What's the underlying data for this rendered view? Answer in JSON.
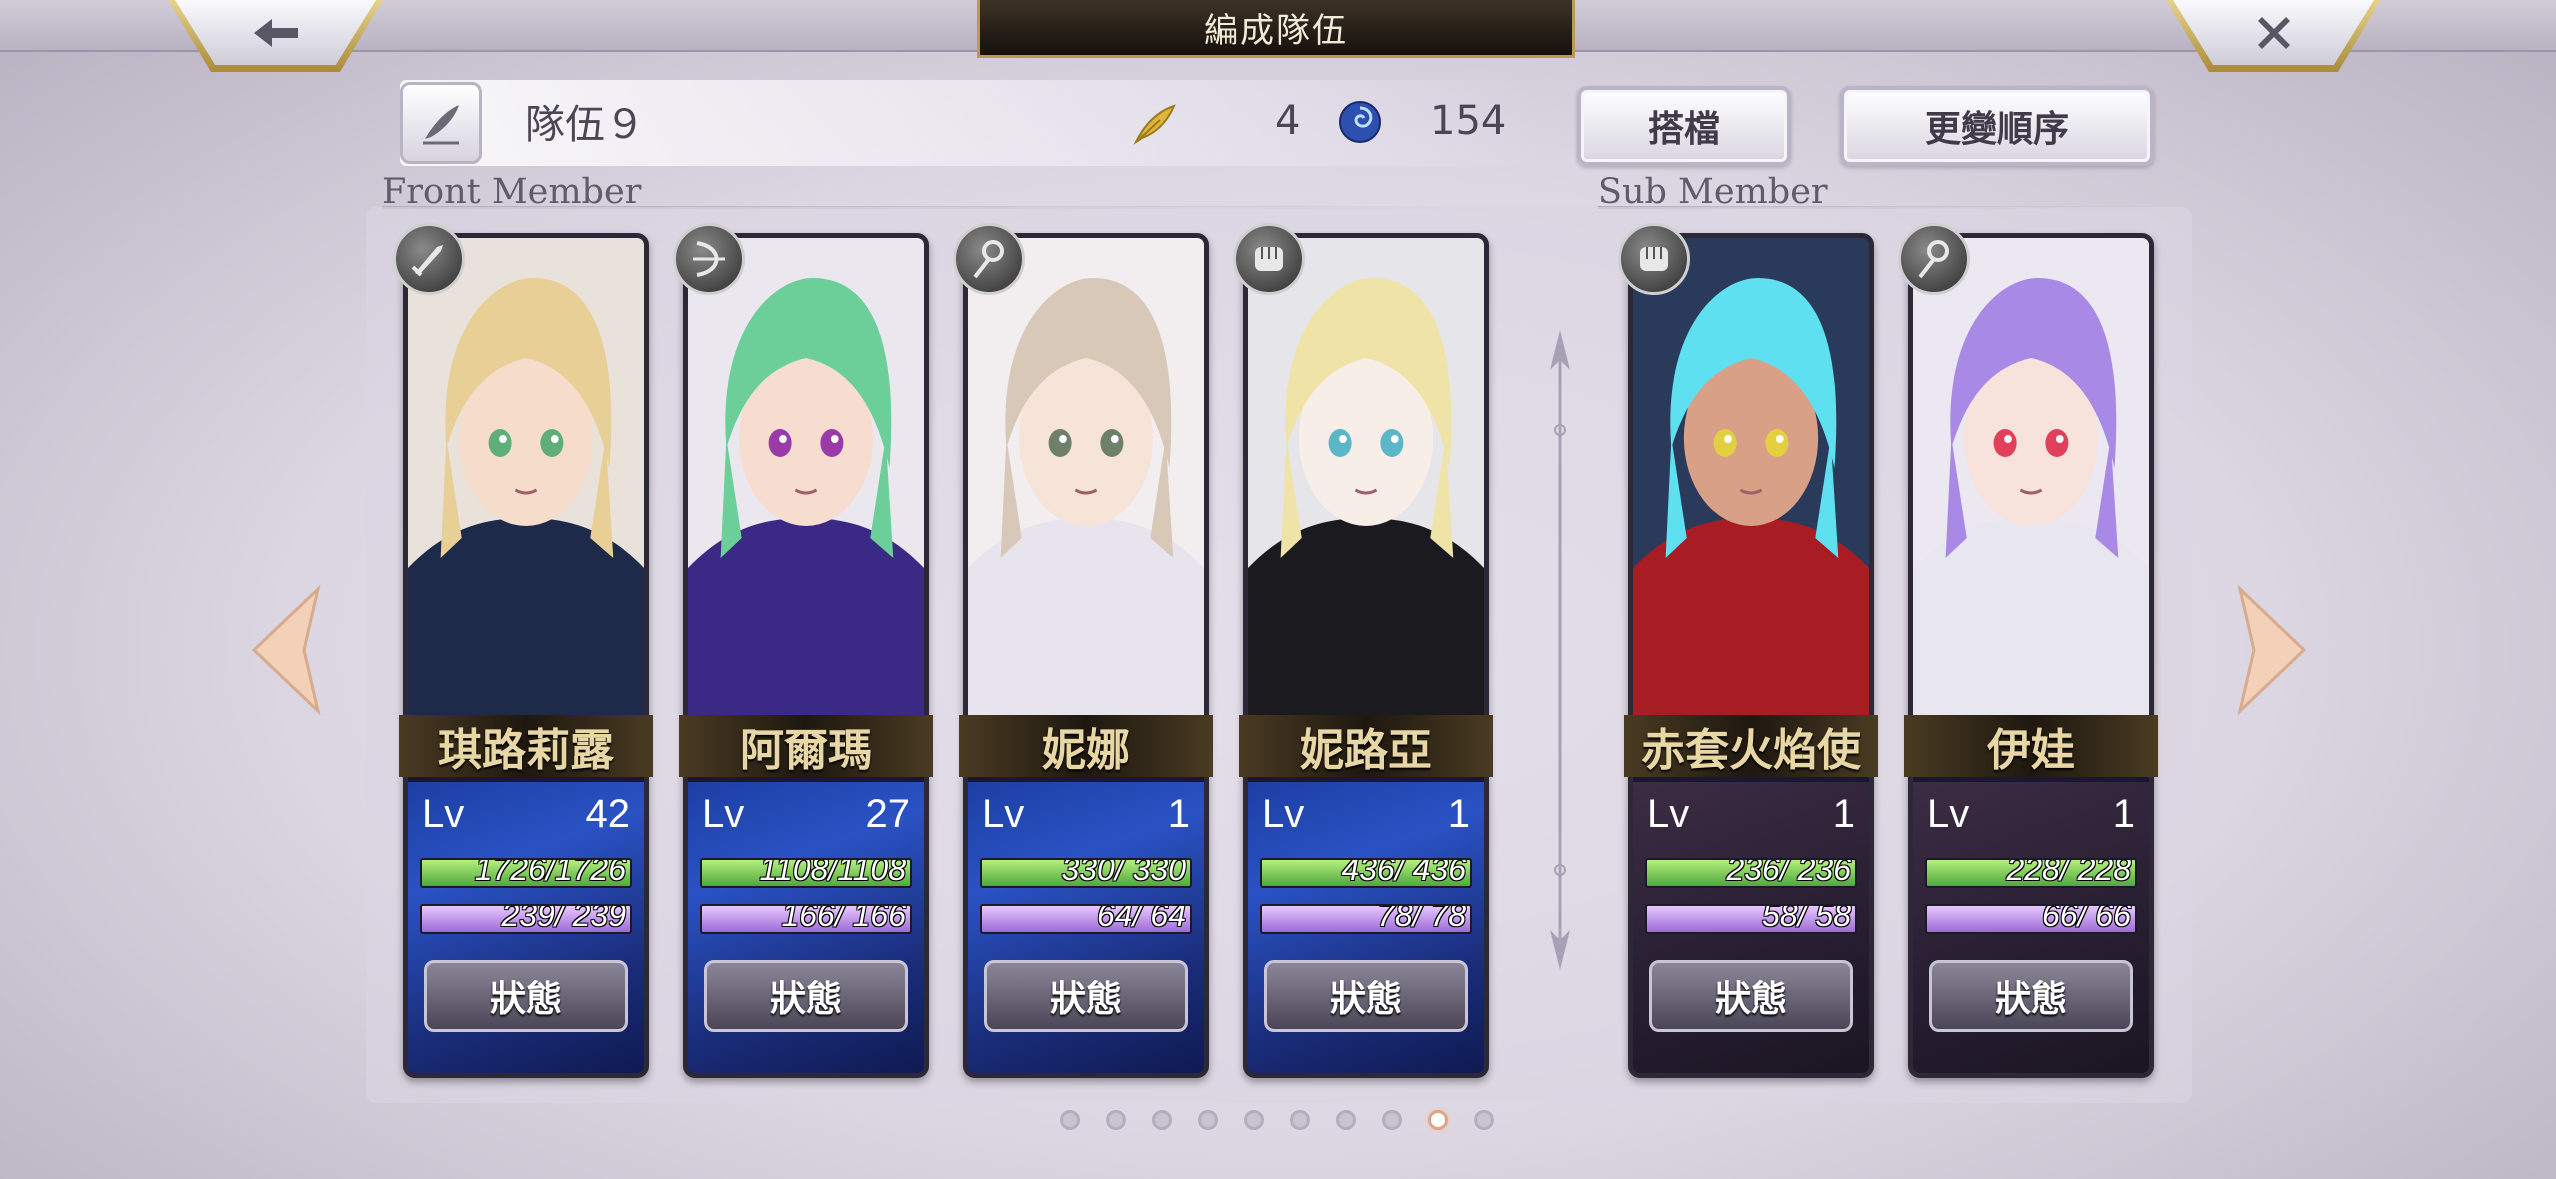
{
  "header": {
    "title": "編成隊伍",
    "back_icon": "back-arrow-icon",
    "close_icon": "close-x-icon"
  },
  "team": {
    "name": "隊伍９",
    "feather_count": "4",
    "orb_count": "154"
  },
  "buttons": {
    "partner": "搭檔",
    "reorder": "更變順序"
  },
  "sections": {
    "front": "Front Member",
    "sub": "Sub Member"
  },
  "front_members": [
    {
      "name": "琪路莉露",
      "lv_label": "Lv",
      "level": "42",
      "hp": "1726/1726",
      "mp": "239/ 239",
      "hp_fill": 1.0,
      "mp_fill": 1.0,
      "weapon": "sword-icon",
      "status": "狀態",
      "theme": "blue",
      "art": {
        "hair": "#e8cf96",
        "skin": "#f6dccb",
        "cloth": "#1e2a4a",
        "eye": "#5fae7a",
        "bg": "#e8e2da"
      }
    },
    {
      "name": "阿爾瑪",
      "lv_label": "Lv",
      "level": "27",
      "hp": "1108/1108",
      "mp": "166/ 166",
      "hp_fill": 1.0,
      "mp_fill": 1.0,
      "weapon": "bow-icon",
      "status": "狀態",
      "theme": "blue",
      "art": {
        "hair": "#6ccf9a",
        "skin": "#f6ddd0",
        "cloth": "#3a2a86",
        "eye": "#9a3aa8",
        "bg": "#eae8ee"
      }
    },
    {
      "name": "妮娜",
      "lv_label": "Lv",
      "level": "1",
      "hp": "330/ 330",
      "mp": "64/ 64",
      "hp_fill": 1.0,
      "mp_fill": 1.0,
      "weapon": "staff-icon",
      "status": "狀態",
      "theme": "blue",
      "art": {
        "hair": "#d8c8b8",
        "skin": "#f7e4d8",
        "cloth": "#e8e4ee",
        "eye": "#6e7f6a",
        "bg": "#f2eef0"
      }
    },
    {
      "name": "妮路亞",
      "lv_label": "Lv",
      "level": "1",
      "hp": "436/ 436",
      "mp": "78/ 78",
      "hp_fill": 1.0,
      "mp_fill": 1.0,
      "weapon": "fist-icon",
      "status": "狀態",
      "theme": "blue",
      "art": {
        "hair": "#f0e3a8",
        "skin": "#f8eee8",
        "cloth": "#1b1b1f",
        "eye": "#5bb6c7",
        "bg": "#e6e6ea"
      }
    }
  ],
  "sub_members": [
    {
      "name": "赤套火焰使",
      "lv_label": "Lv",
      "level": "1",
      "hp": "236/ 236",
      "mp": "58/ 58",
      "hp_fill": 1.0,
      "mp_fill": 1.0,
      "weapon": "fist-icon",
      "status": "狀態",
      "theme": "dark",
      "art": {
        "hair": "#5fe0f0",
        "skin": "#d9a088",
        "cloth": "#a81c24",
        "eye": "#e2d040",
        "bg": "#2a3a5a"
      }
    },
    {
      "name": "伊娃",
      "lv_label": "Lv",
      "level": "1",
      "hp": "228/ 228",
      "mp": "66/ 66",
      "hp_fill": 1.0,
      "mp_fill": 1.0,
      "weapon": "staff-icon",
      "status": "狀態",
      "theme": "dark",
      "art": {
        "hair": "#a88ae6",
        "skin": "#f8e2dc",
        "cloth": "#e8e6ee",
        "eye": "#e0405a",
        "bg": "#ece8f2"
      }
    }
  ],
  "pagination": {
    "pages": 10,
    "current": 9
  },
  "colors": {
    "accent_gold": "#b89a52",
    "hp_green": "#4fa83c",
    "mp_purple": "#9c6ad6",
    "arrow_peach": "#f3d0b8"
  }
}
